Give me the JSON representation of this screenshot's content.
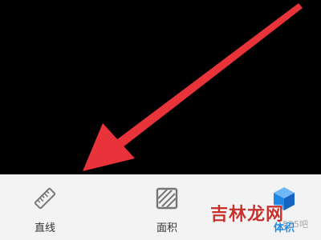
{
  "modes": [
    {
      "label": "直线",
      "icon": "ruler-icon",
      "active": false
    },
    {
      "label": "面积",
      "icon": "area-icon",
      "active": false
    },
    {
      "label": "体积",
      "icon": "cube-icon",
      "active": true
    }
  ],
  "watermark": {
    "brand": "吉林龙网",
    "site": "525吧"
  },
  "colors": {
    "accent": "#1e88e5",
    "annotation": "#e8333a",
    "bar_bg": "#f3f3f3"
  }
}
